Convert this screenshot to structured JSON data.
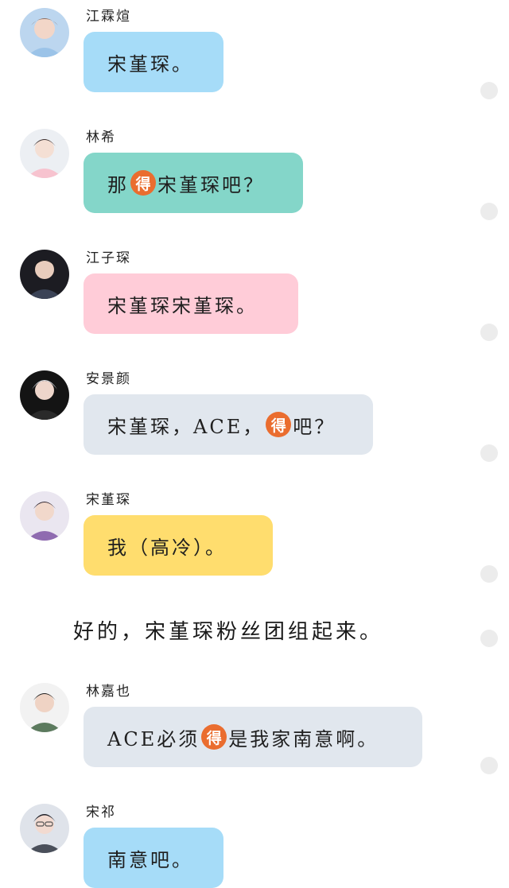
{
  "colors": {
    "blue_bubble": "#a6dcf8",
    "teal_bubble": "#84d6c9",
    "pink_bubble": "#ffccd8",
    "gray_bubble": "#e1e7ee",
    "yellow_bubble": "#ffdd6e",
    "de_badge": "#ea6d2f",
    "dot": "#ececec"
  },
  "messages": [
    {
      "name": "江霖煊",
      "avatar_icon": "user-avatar-icon",
      "parts": [
        "宋堇琛。"
      ]
    },
    {
      "name": "林希",
      "avatar_icon": "user-avatar-icon",
      "parts": [
        "那",
        "得",
        "宋堇琛吧？"
      ]
    },
    {
      "name": "江子琛",
      "avatar_icon": "user-avatar-icon",
      "parts": [
        "宋堇琛宋堇琛。"
      ]
    },
    {
      "name": "安景颜",
      "avatar_icon": "user-avatar-icon",
      "parts": [
        "宋堇琛，ACE，",
        "得",
        "吧？"
      ]
    },
    {
      "name": "宋堇琛",
      "avatar_icon": "user-avatar-icon",
      "parts": [
        "我（高冷）。"
      ]
    },
    {
      "name": "林嘉也",
      "avatar_icon": "user-avatar-icon",
      "parts": [
        "ACE必须",
        "得",
        "是我家南意啊。"
      ]
    },
    {
      "name": "宋祁",
      "avatar_icon": "user-avatar-icon",
      "parts": [
        "南意吧。"
      ]
    }
  ],
  "narration": "好的，宋堇琛粉丝团组起来。"
}
